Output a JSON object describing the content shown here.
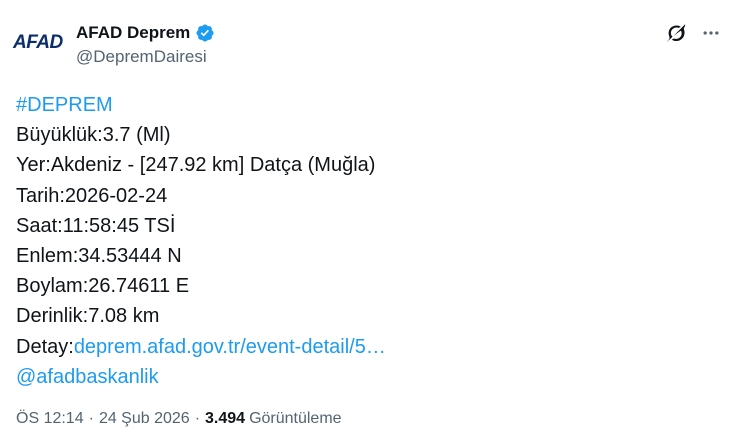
{
  "author": {
    "logo_main": "AFAD",
    "logo_accent": "",
    "display_name": "AFAD Deprem",
    "handle": "@DepremDairesi",
    "verified_icon": "verified-badge-icon"
  },
  "actions": {
    "grok_icon": "grok-icon",
    "more_icon": "more-horizontal-icon"
  },
  "tweet": {
    "hashtag": "#DEPREM",
    "magnitude": "Büyüklük:3.7 (Ml)",
    "location": "Yer:Akdeniz - [247.92 km] Datça (Muğla)",
    "date": "Tarih:2026-02-24",
    "time": "Saat:11:58:45 TSİ",
    "latitude": "Enlem:34.53444 N",
    "longitude": "Boylam:26.74611 E",
    "depth": "Derinlik:7.08 km",
    "detail_label": "Detay:",
    "detail_link": "deprem.afad.gov.tr/event-detail/5…",
    "mention": "@afadbaskanlik"
  },
  "meta": {
    "time": "ÖS 12:14",
    "separator": "·",
    "date": "24 Şub 2026",
    "views_count": "3.494",
    "views_label": "Görüntüleme"
  },
  "colors": {
    "link": "#1d9bf0",
    "verified": "#1d9bf0",
    "text": "#0f1419",
    "secondary": "#536471"
  }
}
